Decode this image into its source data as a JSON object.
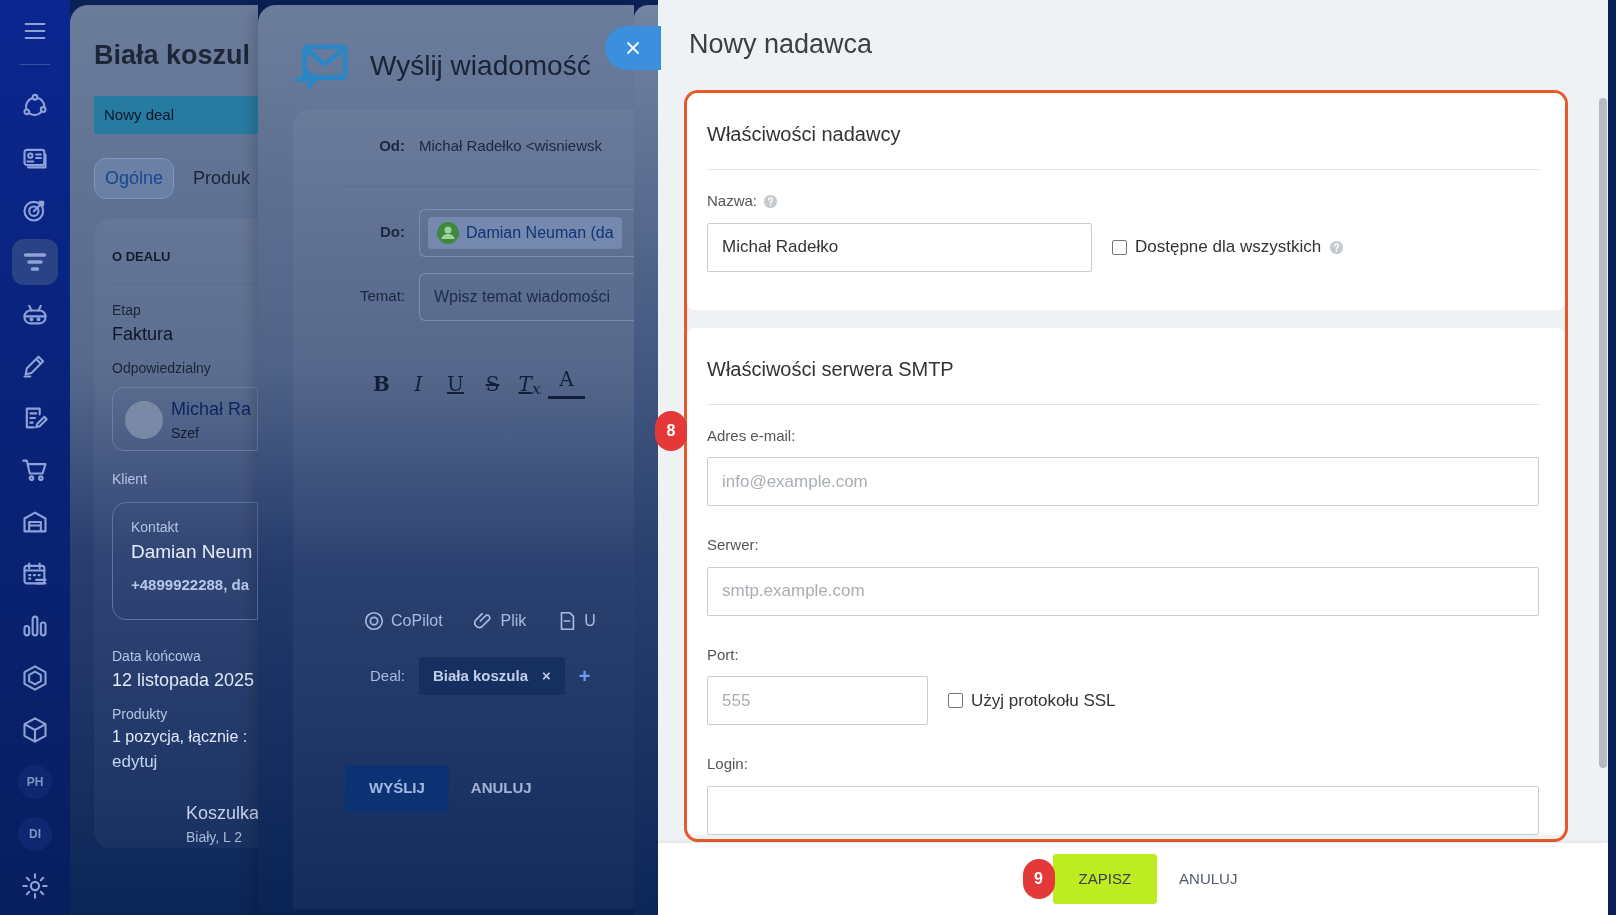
{
  "sidebar": {
    "items": [
      {
        "kind": "menu",
        "selected": false
      },
      {
        "kind": "nodes",
        "selected": false
      },
      {
        "kind": "card",
        "selected": false
      },
      {
        "kind": "target",
        "selected": false
      },
      {
        "kind": "funnel",
        "selected": true
      },
      {
        "kind": "robot",
        "selected": false
      },
      {
        "kind": "pen",
        "selected": false
      },
      {
        "kind": "doc",
        "selected": false
      },
      {
        "kind": "cart",
        "selected": false
      },
      {
        "kind": "warehouse",
        "selected": false
      },
      {
        "kind": "calendar",
        "selected": false
      },
      {
        "kind": "chart",
        "selected": false
      },
      {
        "kind": "hexagon",
        "selected": false
      },
      {
        "kind": "cube",
        "selected": false
      },
      {
        "kind": "avatar",
        "label": "PH",
        "selected": false
      },
      {
        "kind": "avatar",
        "label": "DI",
        "selected": false
      },
      {
        "kind": "gear",
        "selected": false
      }
    ]
  },
  "deal_panel": {
    "title": "Biała koszul",
    "stage": "Nowy deal",
    "tabs": [
      {
        "label": "Ogólne",
        "selected": true
      },
      {
        "label": "Produk",
        "selected": false
      }
    ],
    "section_title": "O DEALU",
    "stage_field": {
      "label": "Etap",
      "value": "Faktura"
    },
    "responsible": {
      "label": "Odpowiedzialny",
      "name": "Michał Ra",
      "role": "Szef"
    },
    "client": {
      "label": "Klient",
      "type": "Kontakt",
      "name": "Damian Neum",
      "details": "+4899922288, da"
    },
    "end_date": {
      "label": "Data końcowa",
      "value": "12 listopada 2025"
    },
    "products": {
      "label": "Produkty",
      "summary": "1 pozycja, łącznie :",
      "link": "edytuj",
      "item_name": "Koszulka",
      "item_details": "Biały, L  2"
    }
  },
  "email_panel": {
    "title": "Wyślij wiadomość",
    "from": {
      "label": "Od:",
      "value": "Michał Radełko <wisniewsk"
    },
    "to": {
      "label": "Do:",
      "recipient": "Damian Neuman (da"
    },
    "subject": {
      "label": "Temat:",
      "placeholder": "Wpisz temat wiadomości"
    },
    "toolbar": [
      {
        "kind": "bold",
        "label": "B"
      },
      {
        "kind": "italic",
        "label": "I"
      },
      {
        "kind": "underline",
        "label": "U"
      },
      {
        "kind": "strike",
        "label": "S"
      },
      {
        "kind": "clear",
        "label": "T$_{x}$"
      },
      {
        "kind": "color",
        "label": "A"
      }
    ],
    "attachments": [
      {
        "kind": "copilot",
        "label": "CoPilot"
      },
      {
        "kind": "file",
        "label": "Plik"
      },
      {
        "kind": "doc",
        "label": "U"
      }
    ],
    "deal": {
      "label": "Deal:",
      "chip": "Biała koszula",
      "remove": "×",
      "add": "+"
    },
    "buttons": [
      {
        "kind": "primary",
        "label": "WYŚLIJ"
      },
      {
        "kind": "link",
        "label": "ANULUJ"
      }
    ]
  },
  "sender_panel": {
    "title": "Nowy nadawca",
    "sections": [
      {
        "title": "Właściwości nadawcy",
        "fields": [
          {
            "kind": "name",
            "label": "Nazwa:",
            "help": true,
            "value": "Michał Radełko",
            "checkbox": {
              "label": "Dostępne dla wszystkich",
              "checked": false,
              "help": true
            }
          }
        ]
      },
      {
        "title": "Właściwości serwera SMTP",
        "fields": [
          {
            "kind": "email",
            "label": "Adres e-mail:",
            "help": false,
            "placeholder": "info@example.com"
          },
          {
            "kind": "server",
            "label": "Serwer:",
            "help": false,
            "placeholder": "smtp.example.com"
          },
          {
            "kind": "port",
            "label": "Port:",
            "help": false,
            "placeholder": "555",
            "checkbox": {
              "label": "Użyj protokołu SSL",
              "checked": false,
              "help": false
            }
          },
          {
            "kind": "login",
            "label": "Login:",
            "help": false
          }
        ]
      }
    ],
    "buttons": [
      {
        "kind": "primary",
        "label": "ZAPISZ"
      },
      {
        "kind": "link",
        "label": "ANULUJ"
      }
    ]
  },
  "annotations": [
    {
      "label": "8"
    },
    {
      "label": "9"
    }
  ]
}
